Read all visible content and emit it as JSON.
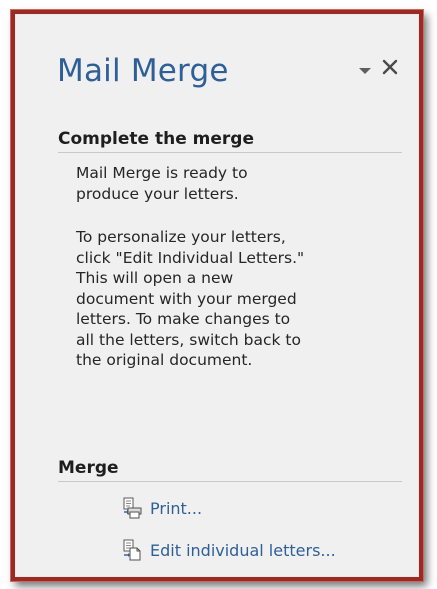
{
  "pane": {
    "title": "Mail Merge"
  },
  "complete_section": {
    "heading": "Complete the merge",
    "ready_text_line1": "Mail Merge is ready to",
    "ready_text_line2": "produce your letters.",
    "instructions_lines": [
      "To personalize your letters,",
      "click \"Edit Individual Letters.\"",
      "This will open a new",
      "document with your merged",
      "letters. To make changes to",
      "all the letters, switch back to",
      "the original document."
    ]
  },
  "merge_section": {
    "heading": "Merge",
    "actions": [
      {
        "label": "Print...",
        "icon": "print-icon"
      },
      {
        "label": "Edit individual letters...",
        "icon": "edit-letters-icon"
      }
    ]
  },
  "colors": {
    "title": "#2e5f97",
    "link": "#2e5f97",
    "frame_border": "#9a2a23",
    "pane_background": "#f0f0f0"
  }
}
